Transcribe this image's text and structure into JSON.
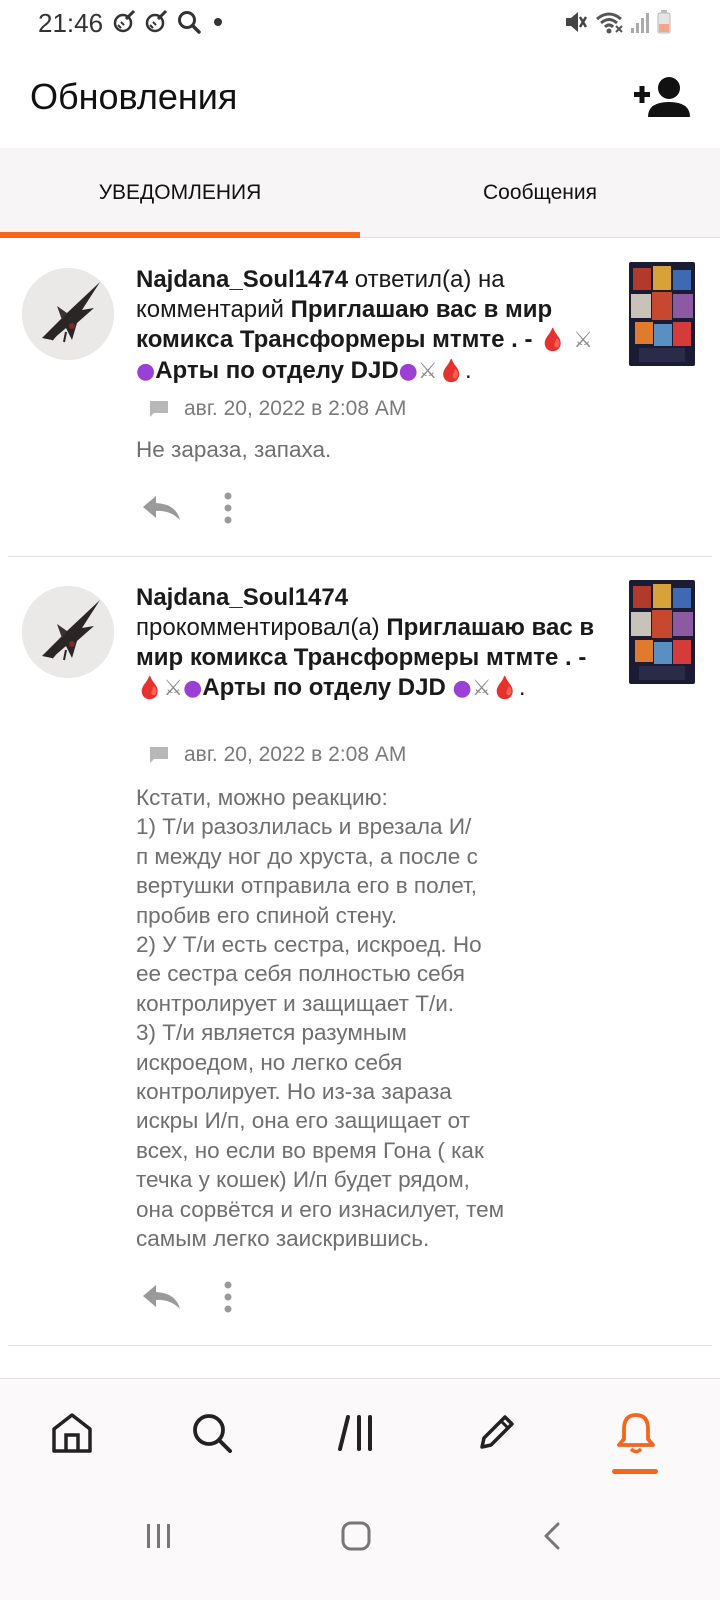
{
  "status_bar": {
    "time": "21:46",
    "left_icons": [
      "broom-icon",
      "broom-icon",
      "search-icon",
      "dot-icon"
    ],
    "right_icons": [
      "mute-icon",
      "wifi-icon",
      "signal-icon",
      "battery-icon"
    ]
  },
  "app_bar": {
    "title": "Обновления",
    "action_icon": "add-user-icon"
  },
  "tabs": [
    {
      "label": "УВЕДОМЛЕНИЯ",
      "active": true
    },
    {
      "label": "Сообщения",
      "active": false
    }
  ],
  "accent_color": "#f4661b",
  "notifications": [
    {
      "user": "Najdana_Soul1474",
      "action": "ответил(а) на комментарий",
      "story": "Приглашаю вас в мир комикса Трансформеры мтмте . -",
      "story_line1": "Приглашаю вас в мир",
      "story_line2": "комикса Трансформеры мтмте . -",
      "story_tail": "Арты по отделу DJD",
      "timestamp": "авг. 20, 2022 в 2:08 AM",
      "message": "Не зараза, запаха."
    },
    {
      "user": "Najdana_Soul1474",
      "action": "прокомментировал(а)",
      "story_line1": "Приглашаю",
      "story_line2": "вас в мир комикса Трансформеры",
      "story_line3": "мтмте . -",
      "story_tail": "Арты по отделу DJD",
      "timestamp": "авг. 20, 2022 в 2:08 AM",
      "message": "Кстати, можно реакцию:\n1) Т/и разозлилась и врезала И/\nп между ног до хруста, а после с\nвертушки отправила его в полет,\nпробив его спиной стену.\n2) У Т/и есть сестра, искроед. Но\nее сестра себя полностью себя\nконтролирует и защищает Т/и.\n3) Т/и является разумным\nискроедом, но легко себя\nконтролирует. Но из-за зараза\nискры И/п, она его защищает от\nвсех, но если во время Гона ( как\nтечка у кошек) И/п будет рядом,\nона сорвётся и его изнасилует, тем\nсамым легко заискрившись."
    }
  ],
  "bottom_nav": [
    {
      "name": "home-icon",
      "active": false
    },
    {
      "name": "search-icon",
      "active": false
    },
    {
      "name": "library-icon",
      "active": false
    },
    {
      "name": "write-icon",
      "active": false
    },
    {
      "name": "notifications-bell-icon",
      "active": true
    }
  ],
  "system_nav": [
    "recents-icon",
    "home-icon",
    "back-icon"
  ]
}
